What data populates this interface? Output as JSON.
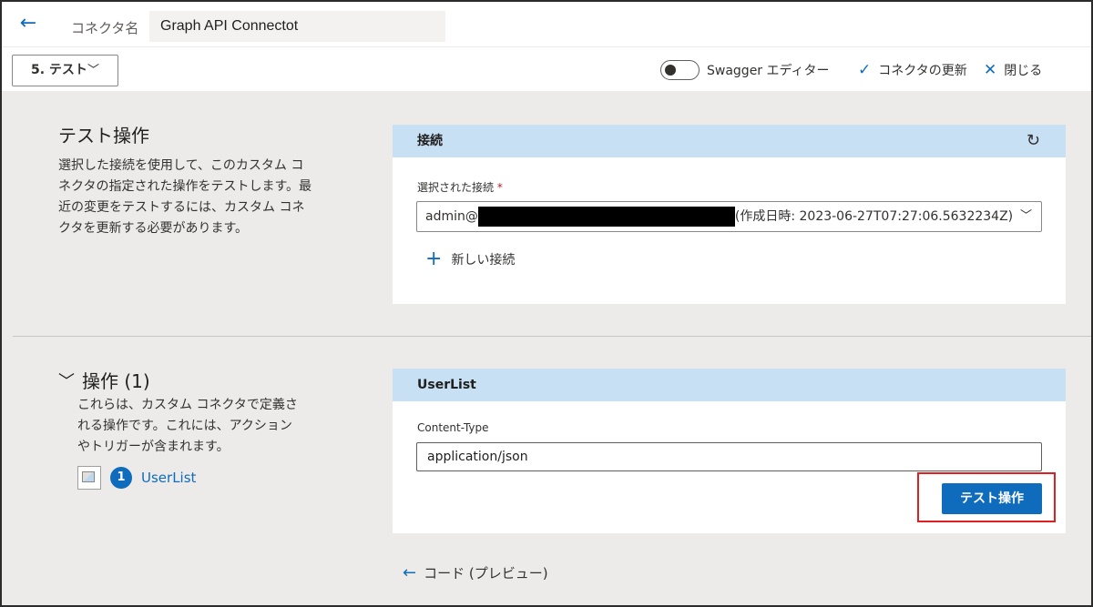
{
  "header": {
    "back_icon": "←",
    "name_label": "コネクタ名",
    "connector_name": "Graph API Connectot"
  },
  "toolbar": {
    "step_label": "5. テスト",
    "chevron": "﹀",
    "swagger_label": "Swagger エディター",
    "swagger_toggle_on": false,
    "update_icon": "✓",
    "update_label": "コネクタの更新",
    "close_icon": "✕",
    "close_label": "閉じる"
  },
  "test_section": {
    "title": "テスト操作",
    "description": "選択した接続を使用して、このカスタム コネクタの指定された操作をテストします。最近の変更をテストするには、カスタム コネクタを更新する必要があります。"
  },
  "connection_card": {
    "header": "接続",
    "refresh_icon": "↻",
    "field_label": "選択された接続",
    "required_mark": "*",
    "selected_prefix": "admin@",
    "selected_suffix": "(作成日時: 2023-06-27T07:27:06.5632234Z)",
    "new_connection_icon": "+",
    "new_connection_label": "新しい接続"
  },
  "operations_section": {
    "collapse_icon": "﹀",
    "title": "操作 (1)",
    "description": "これらは、カスタム コネクタで定義される操作です。これには、アクションやトリガーが含まれます。",
    "items": [
      {
        "number": "1",
        "name": "UserList"
      }
    ]
  },
  "operation_card": {
    "header": "UserList",
    "field_label": "Content-Type",
    "field_value": "application/json",
    "test_button": "テスト操作"
  },
  "footer": {
    "code_icon": "←",
    "code_label": "コード (プレビュー)"
  },
  "colors": {
    "accent": "#0f6cbd",
    "card_header": "#c7e0f4",
    "page_background": "#edebe9",
    "highlight": "#e02020"
  }
}
